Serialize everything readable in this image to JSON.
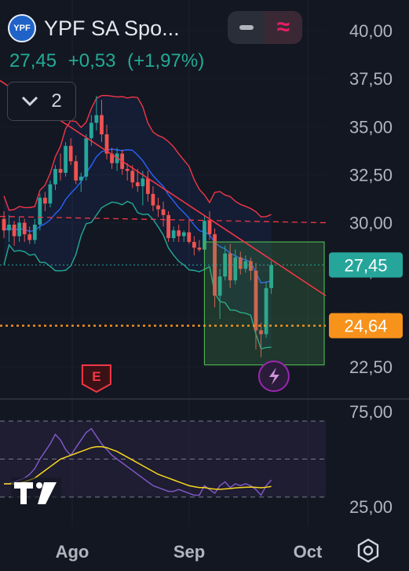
{
  "header": {
    "logo_text": "YPF",
    "symbol_title": "YPF SA Spo...",
    "last_price": "27,45",
    "change": "+0,53",
    "change_pct": "(+1,97%)"
  },
  "toolbar": {
    "collapse_count": "2",
    "minus_icon": "minus-icon",
    "wave_icon": "wave-icon"
  },
  "colors": {
    "background": "#131722",
    "up": "#26a69a",
    "down": "#ef5350",
    "upper_band": "#f23645",
    "lower_band": "#22ab94",
    "basis": "#2962ff",
    "trendline": "#f23645",
    "support": "#f7921b",
    "rsi": "#7e57c2",
    "rsi_ma": "#f9d71c"
  },
  "chart_data": [
    {
      "type": "candlestick",
      "price_axis": [
        "40,00",
        "37,50",
        "35,00",
        "32,50",
        "30,00",
        "27,50",
        "25,00",
        "22,50"
      ],
      "ylim": [
        22.0,
        41.0
      ],
      "time_axis": [
        "Ago",
        "Sep",
        "Oct"
      ],
      "last_price_label": "27,45",
      "support_label": "24,64",
      "support_level": 24.64,
      "trendline_level": 30.0,
      "ohlc": [
        [
          30.2,
          30.6,
          29.2,
          29.6
        ],
        [
          29.6,
          30.4,
          29.0,
          29.9
        ],
        [
          29.9,
          30.1,
          28.8,
          29.3
        ],
        [
          29.3,
          30.3,
          29.0,
          30.0
        ],
        [
          30.0,
          30.2,
          29.0,
          29.4
        ],
        [
          29.4,
          29.8,
          28.9,
          29.1
        ],
        [
          29.1,
          30.2,
          28.9,
          29.9
        ],
        [
          29.9,
          31.5,
          29.6,
          31.3
        ],
        [
          31.3,
          31.6,
          30.6,
          31.0
        ],
        [
          31.0,
          32.2,
          30.8,
          32.0
        ],
        [
          32.0,
          33.0,
          31.7,
          32.8
        ],
        [
          32.8,
          33.6,
          32.2,
          32.6
        ],
        [
          32.6,
          34.2,
          32.4,
          34.0
        ],
        [
          34.0,
          34.4,
          33.0,
          33.2
        ],
        [
          33.2,
          33.5,
          32.0,
          32.2
        ],
        [
          32.2,
          32.6,
          31.6,
          32.4
        ],
        [
          32.4,
          34.6,
          32.2,
          34.4
        ],
        [
          34.4,
          35.6,
          34.0,
          35.2
        ],
        [
          35.2,
          36.6,
          34.8,
          35.6
        ],
        [
          35.6,
          36.4,
          34.2,
          34.6
        ],
        [
          34.6,
          35.1,
          33.3,
          33.6
        ],
        [
          33.6,
          33.9,
          32.8,
          33.1
        ],
        [
          33.1,
          33.9,
          32.7,
          33.6
        ],
        [
          33.6,
          33.8,
          32.5,
          32.8
        ],
        [
          32.8,
          33.1,
          32.2,
          32.7
        ],
        [
          32.7,
          33.0,
          31.8,
          32.1
        ],
        [
          32.1,
          32.8,
          31.6,
          31.9
        ],
        [
          31.9,
          32.7,
          30.9,
          32.3
        ],
        [
          32.3,
          32.7,
          31.1,
          31.5
        ],
        [
          31.5,
          31.9,
          30.6,
          30.9
        ],
        [
          30.9,
          31.3,
          30.3,
          30.7
        ],
        [
          30.7,
          31.1,
          29.8,
          30.4
        ],
        [
          30.4,
          30.6,
          29.0,
          29.2
        ],
        [
          29.2,
          29.8,
          29.0,
          29.6
        ],
        [
          29.6,
          29.9,
          29.0,
          29.3
        ],
        [
          29.3,
          29.6,
          29.0,
          29.5
        ],
        [
          29.5,
          30.1,
          28.9,
          29.0
        ],
        [
          29.0,
          29.3,
          28.3,
          28.7
        ],
        [
          28.7,
          29.1,
          28.5,
          28.6
        ],
        [
          28.6,
          30.4,
          28.4,
          30.1
        ],
        [
          30.1,
          30.6,
          29.1,
          29.4
        ],
        [
          29.4,
          29.7,
          25.6,
          26.2
        ],
        [
          26.2,
          27.6,
          25.0,
          27.2
        ],
        [
          27.2,
          28.8,
          27.0,
          28.4
        ],
        [
          28.4,
          28.9,
          26.6,
          27.0
        ],
        [
          27.0,
          28.6,
          26.8,
          28.2
        ],
        [
          28.2,
          28.5,
          27.3,
          27.6
        ],
        [
          27.6,
          28.3,
          27.4,
          28.0
        ],
        [
          28.0,
          28.2,
          27.0,
          27.5
        ],
        [
          27.5,
          27.9,
          23.4,
          24.4
        ],
        [
          24.4,
          24.8,
          23.0,
          24.2
        ],
        [
          24.2,
          26.9,
          24.0,
          26.6
        ],
        [
          26.6,
          28.0,
          26.3,
          27.8
        ]
      ]
    },
    {
      "type": "line",
      "name": "RSI",
      "rsi_axis": [
        "75,00",
        "25,00"
      ],
      "ylim": [
        20,
        80
      ],
      "levels": [
        70,
        50,
        30
      ],
      "rsi": [
        37,
        37,
        38,
        39,
        40,
        42,
        45,
        50,
        54,
        58,
        63,
        60,
        55,
        52,
        56,
        60,
        64,
        66,
        62,
        58,
        55,
        52,
        50,
        48,
        46,
        44,
        42,
        40,
        38,
        36,
        35,
        34,
        33,
        33,
        34,
        33,
        32,
        31,
        31,
        36,
        34,
        32,
        36,
        38,
        35,
        37,
        36,
        37,
        36,
        34,
        31,
        36,
        39
      ],
      "rsi_ma": [
        37,
        37,
        37,
        37.5,
        38,
        39,
        40,
        42,
        44,
        46,
        48,
        50,
        51,
        52,
        53,
        54,
        55,
        56,
        56.5,
        56.5,
        56,
        55,
        54,
        52.5,
        51,
        49.5,
        48,
        46.5,
        45,
        43.5,
        42,
        41,
        40,
        39,
        38,
        37,
        36,
        35.5,
        35,
        35,
        34.5,
        34.2,
        34.1,
        34.3,
        34.5,
        34.8,
        35,
        35.2,
        35.3,
        35.1,
        34.9,
        35.2,
        35.6
      ]
    }
  ],
  "markers": {
    "earnings_letter": "E",
    "dividend_icon": "lightning-icon"
  },
  "branding": {
    "watermark": "TV"
  }
}
